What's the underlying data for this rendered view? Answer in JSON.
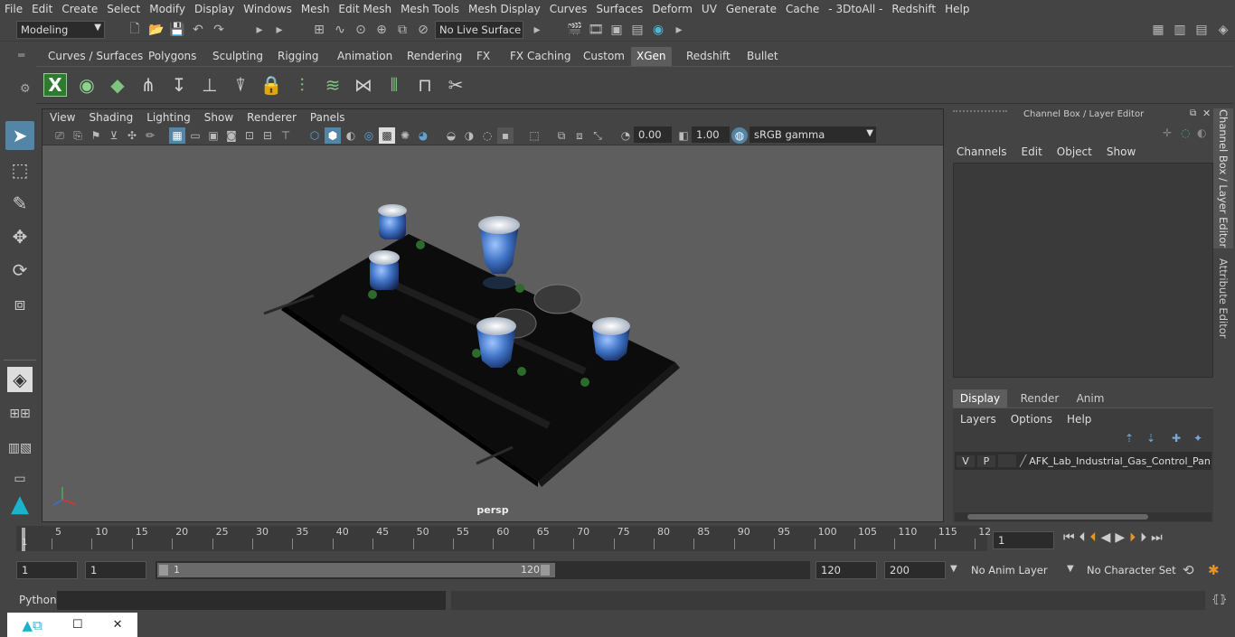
{
  "menubar": [
    "File",
    "Edit",
    "Create",
    "Select",
    "Modify",
    "Display",
    "Windows",
    "Mesh",
    "Edit Mesh",
    "Mesh Tools",
    "Mesh Display",
    "Curves",
    "Surfaces",
    "Deform",
    "UV",
    "Generate",
    "Cache",
    "- 3DtoAll -",
    "Redshift",
    "Help"
  ],
  "status": {
    "mode": "Modeling",
    "live_surface": "No Live Surface"
  },
  "shelf_tabs": [
    "Curves / Surfaces",
    "Polygons",
    "Sculpting",
    "Rigging",
    "Animation",
    "Rendering",
    "FX",
    "FX Caching",
    "Custom",
    "XGen",
    "Redshift",
    "Bullet"
  ],
  "shelf_active": "XGen",
  "viewport": {
    "menus": [
      "View",
      "Shading",
      "Lighting",
      "Show",
      "Renderer",
      "Panels"
    ],
    "exposure": "0.00",
    "gamma": "1.00",
    "colorspace": "sRGB gamma",
    "camera": "persp"
  },
  "channel_box": {
    "title": "Channel Box / Layer Editor",
    "menus": [
      "Channels",
      "Edit",
      "Object",
      "Show"
    ],
    "tabs": [
      "Display",
      "Render",
      "Anim"
    ],
    "active_tab": "Display",
    "layer_menus": [
      "Layers",
      "Options",
      "Help"
    ],
    "layer": {
      "v": "V",
      "p": "P",
      "name": "AFK_Lab_Industrial_Gas_Control_Pan"
    },
    "side_tabs": [
      "Channel Box / Layer Editor",
      "Attribute Editor"
    ]
  },
  "timeline": {
    "ticks": [
      "5",
      "10",
      "15",
      "20",
      "25",
      "30",
      "35",
      "40",
      "45",
      "50",
      "55",
      "60",
      "65",
      "70",
      "75",
      "80",
      "85",
      "90",
      "95",
      "100",
      "105",
      "110",
      "115",
      "12"
    ],
    "start_marker": "1",
    "current_frame": "1"
  },
  "range": {
    "start": "1",
    "playback_start": "1",
    "slider_start": "1",
    "slider_end": "120",
    "end": "120",
    "max": "200",
    "anim_layer": "No Anim Layer",
    "char_set": "No Character Set"
  },
  "cmdline": {
    "label": "Python"
  },
  "colors": {
    "bg": "#444444",
    "viewport": "#5e5e5e",
    "accent": "#5285a6"
  }
}
